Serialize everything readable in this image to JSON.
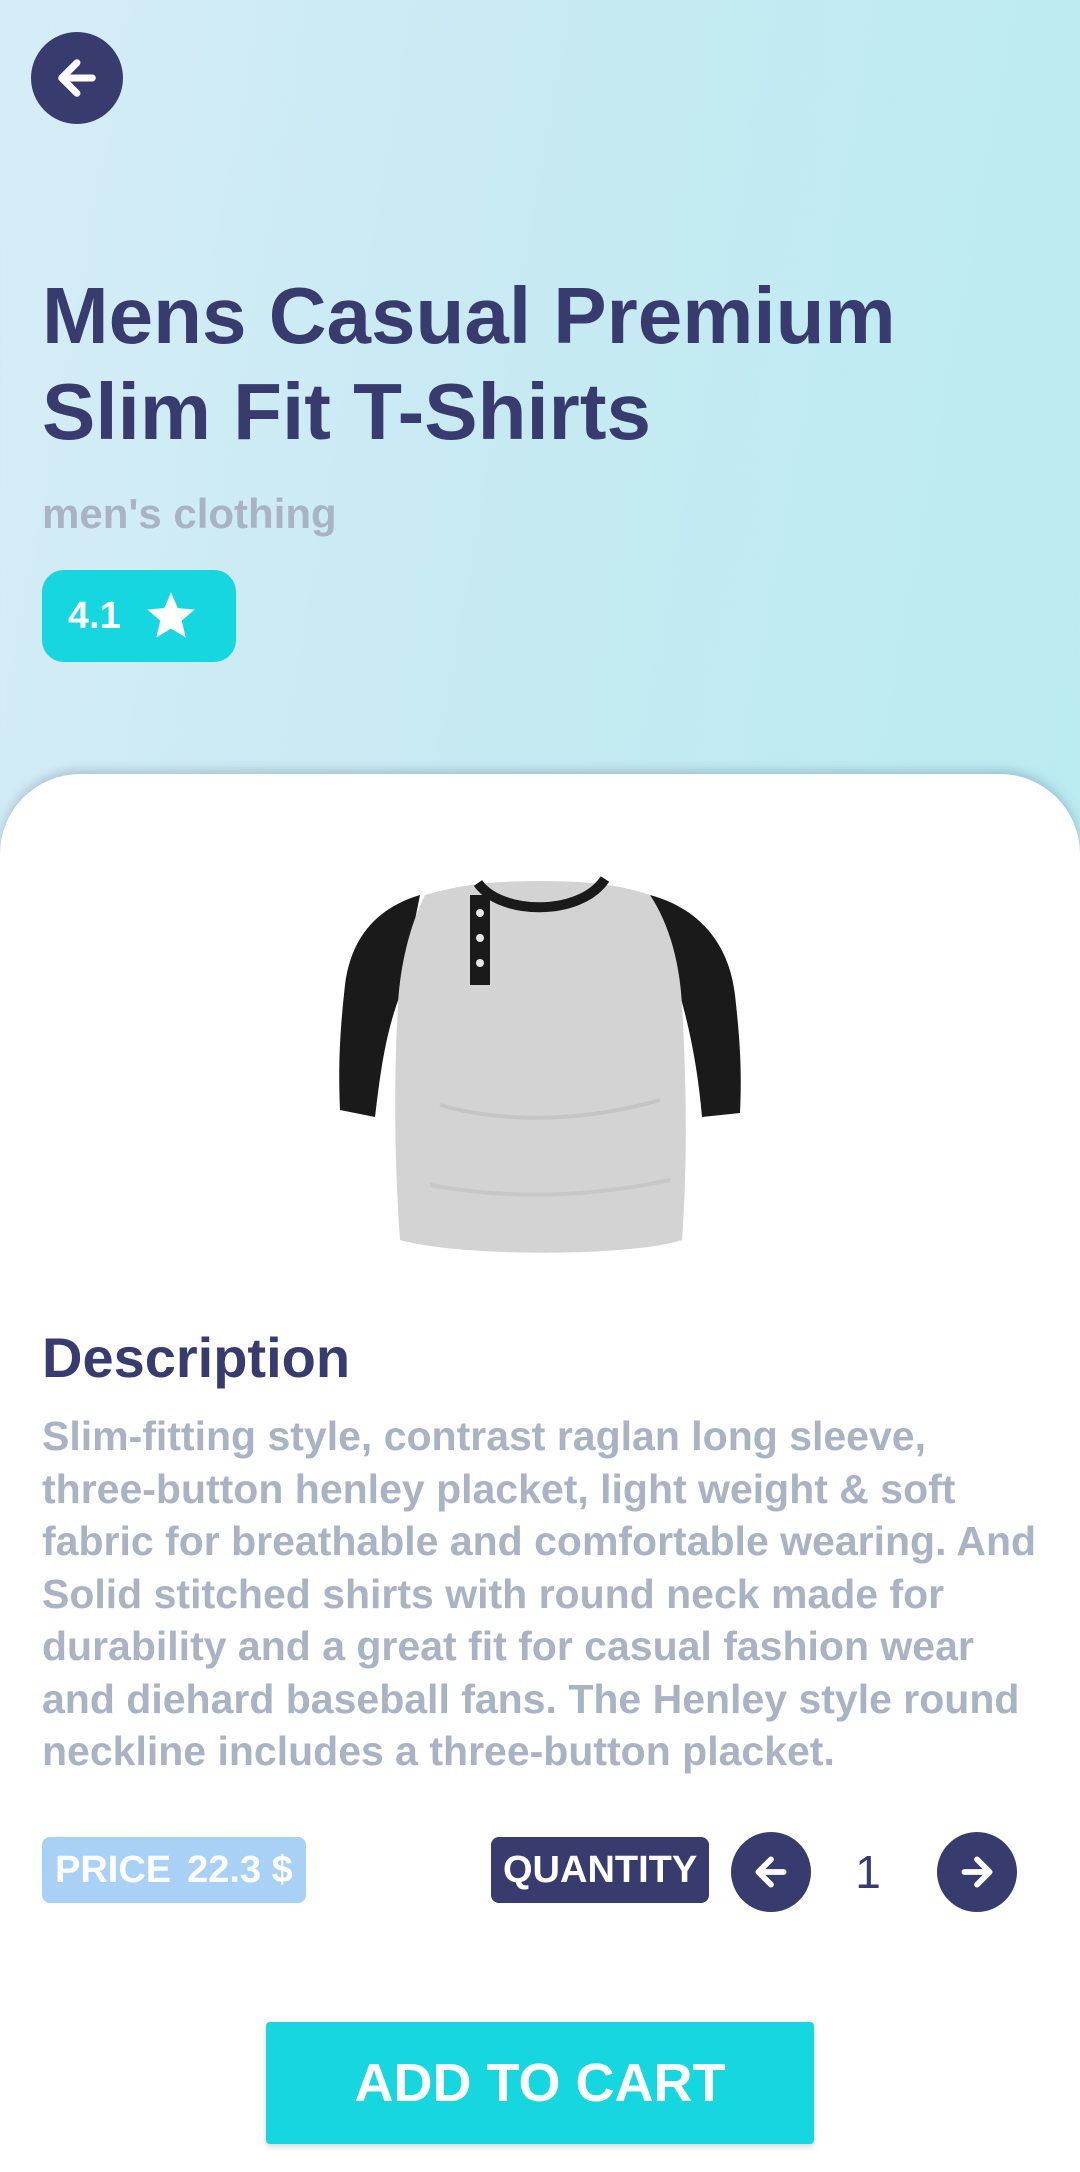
{
  "product": {
    "title": "Mens Casual Premium Slim Fit T-Shirts",
    "category": "men's clothing",
    "rating": "4.1",
    "image_icon": "raglan-henley-tshirt-image"
  },
  "description": {
    "heading": "Description",
    "text": "Slim-fitting style, contrast raglan long sleeve, three-button henley placket, light weight & soft fabric for breathable and comfortable wearing. And Solid stitched shirts with round neck made for durability and a great fit for casual fashion wear and diehard baseball fans. The Henley style round neckline includes a three-button placket."
  },
  "price": {
    "label": "PRICE",
    "value": "22.3 $"
  },
  "quantity": {
    "label": "QUANTITY",
    "value": "1"
  },
  "actions": {
    "add_to_cart": "ADD TO CART"
  },
  "icons": {
    "back": "arrow-left-icon",
    "star": "star-icon",
    "decrease": "arrow-left-icon",
    "increase": "arrow-right-icon"
  },
  "colors": {
    "primary": "#383b6e",
    "accent": "#16d6df",
    "muted_text": "#a9b3c3",
    "price_badge": "#a8d1f5"
  }
}
